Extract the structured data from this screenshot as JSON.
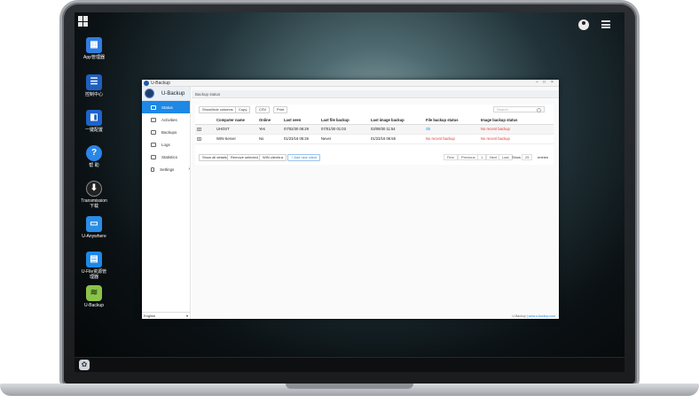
{
  "desktop": {
    "icons": [
      {
        "label": "App管理器",
        "glyph": "▦"
      },
      {
        "label": "控制中心",
        "glyph": "☰"
      },
      {
        "label": "一键配置",
        "glyph": "◧"
      },
      {
        "label": "帮 助",
        "glyph": "?"
      },
      {
        "label": "Transmission 下载",
        "glyph": "⬇"
      },
      {
        "label": "U-Anywhere",
        "glyph": "▭"
      },
      {
        "label": "U-File资源管理器",
        "glyph": "▤"
      },
      {
        "label": "U-Backup",
        "glyph": "≋"
      }
    ]
  },
  "window": {
    "title": "U-Backup",
    "controls": {
      "minimize": "–",
      "maximize": "□",
      "close": "×"
    }
  },
  "sidebar": {
    "brand": "U-Backup",
    "items": [
      {
        "label": "Status",
        "active": true
      },
      {
        "label": "Activities",
        "active": false
      },
      {
        "label": "Backups",
        "active": false
      },
      {
        "label": "Logs",
        "active": false
      },
      {
        "label": "Statistics",
        "active": false
      },
      {
        "label": "Settings",
        "active": false,
        "chevron": "›"
      }
    ],
    "language": "English",
    "language_caret": "▾"
  },
  "main": {
    "breadcrumb": "Backup status",
    "toolbar": {
      "show_hide": "Show/hide columns",
      "copy": "Copy",
      "csv": "CSV",
      "print": "Print",
      "search_placeholder": "Search"
    },
    "table": {
      "headers": [
        "",
        "Computer name",
        "Online",
        "Last seen",
        "Last file backup",
        "Last image backup",
        "File backup status",
        "Image backup status"
      ],
      "rows": [
        {
          "name": "UHOST",
          "online": "Yes",
          "last_seen": "07/02/30 06:29",
          "last_file": "07/01/30 01:03",
          "last_image": "03/09/30 11:54",
          "file_status": "Ok",
          "image_status": "No recent backup"
        },
        {
          "name": "WIN-Server",
          "online": "No",
          "last_seen": "01/23/16 05:26",
          "last_file": "Never",
          "last_image": "01/23/16 06:56",
          "file_status": "No recent backup",
          "image_status": "No recent backup"
        }
      ]
    },
    "actions": {
      "show_all": "Show all details",
      "remove": "Remove selected",
      "win_clients": "WIN clients ▸",
      "add_new": "+ Add new client"
    },
    "pagination": {
      "first": "First",
      "previous": "Previous",
      "page": "1",
      "next": "Next",
      "last": "Last",
      "show_label": "Show",
      "show_value": "25",
      "entries": "entries"
    },
    "footer_text": "U-Backup |",
    "footer_link": "www.u-backup.com"
  }
}
